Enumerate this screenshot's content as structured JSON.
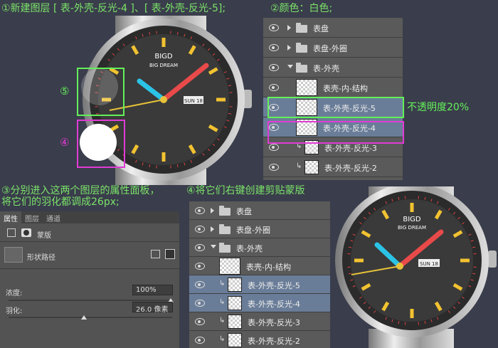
{
  "steps": {
    "s1": "①新建图层 [ 表-外壳-反光-4 ]、[ 表-外壳-反光-5];",
    "s2": "②颜色：白色;",
    "s3a": "③分别进入这两个图层的属性面板，",
    "s3b": "将它们的羽化都调成26px;",
    "s4": "④将它们右键创建剪贴蒙版"
  },
  "markers": {
    "m5": "⑤",
    "m4": "④"
  },
  "opacity_note": "不透明度20%",
  "watch": {
    "brand": "BIGD",
    "sub": "BIG DREAM",
    "date": "SUN 18"
  },
  "layers_top": [
    {
      "name": "表盘",
      "kind": "folder-closed"
    },
    {
      "name": "表盘-外圈",
      "kind": "folder-closed"
    },
    {
      "name": "表-外壳",
      "kind": "folder-open"
    },
    {
      "name": "表壳-内-结构",
      "kind": "layer"
    },
    {
      "name": "表-外壳-反光-5",
      "kind": "layer",
      "selected": true
    },
    {
      "name": "表-外壳-反光-4",
      "kind": "layer",
      "selected": true
    },
    {
      "name": "表-外壳-反光-3",
      "kind": "clip"
    },
    {
      "name": "表-外壳-反光-2",
      "kind": "clip"
    }
  ],
  "layers_bottom": [
    {
      "name": "表盘",
      "kind": "folder-closed"
    },
    {
      "name": "表盘-外圈",
      "kind": "folder-closed"
    },
    {
      "name": "表-外壳",
      "kind": "folder-open"
    },
    {
      "name": "表壳-内-结构",
      "kind": "layer"
    },
    {
      "name": "表-外壳-反光-5",
      "kind": "clip",
      "selected": true
    },
    {
      "name": "表-外壳-反光-4",
      "kind": "clip",
      "selected": true
    },
    {
      "name": "表-外壳-反光-3",
      "kind": "clip"
    },
    {
      "name": "表-外壳-反光-2",
      "kind": "clip"
    }
  ],
  "properties": {
    "tab_props": "属性",
    "tab_layers": "图层",
    "tab_channels": "通道",
    "mask_label": "蒙版",
    "shape_path": "形状路径",
    "density_label": "浓度:",
    "density_value": "100%",
    "feather_label": "羽化:",
    "feather_value": "26.0 像素"
  },
  "colors": {
    "accent_green": "#63f05a",
    "accent_magenta": "#e13bd6",
    "panel": "#5a5a5a",
    "selected": "#6a7d98"
  }
}
